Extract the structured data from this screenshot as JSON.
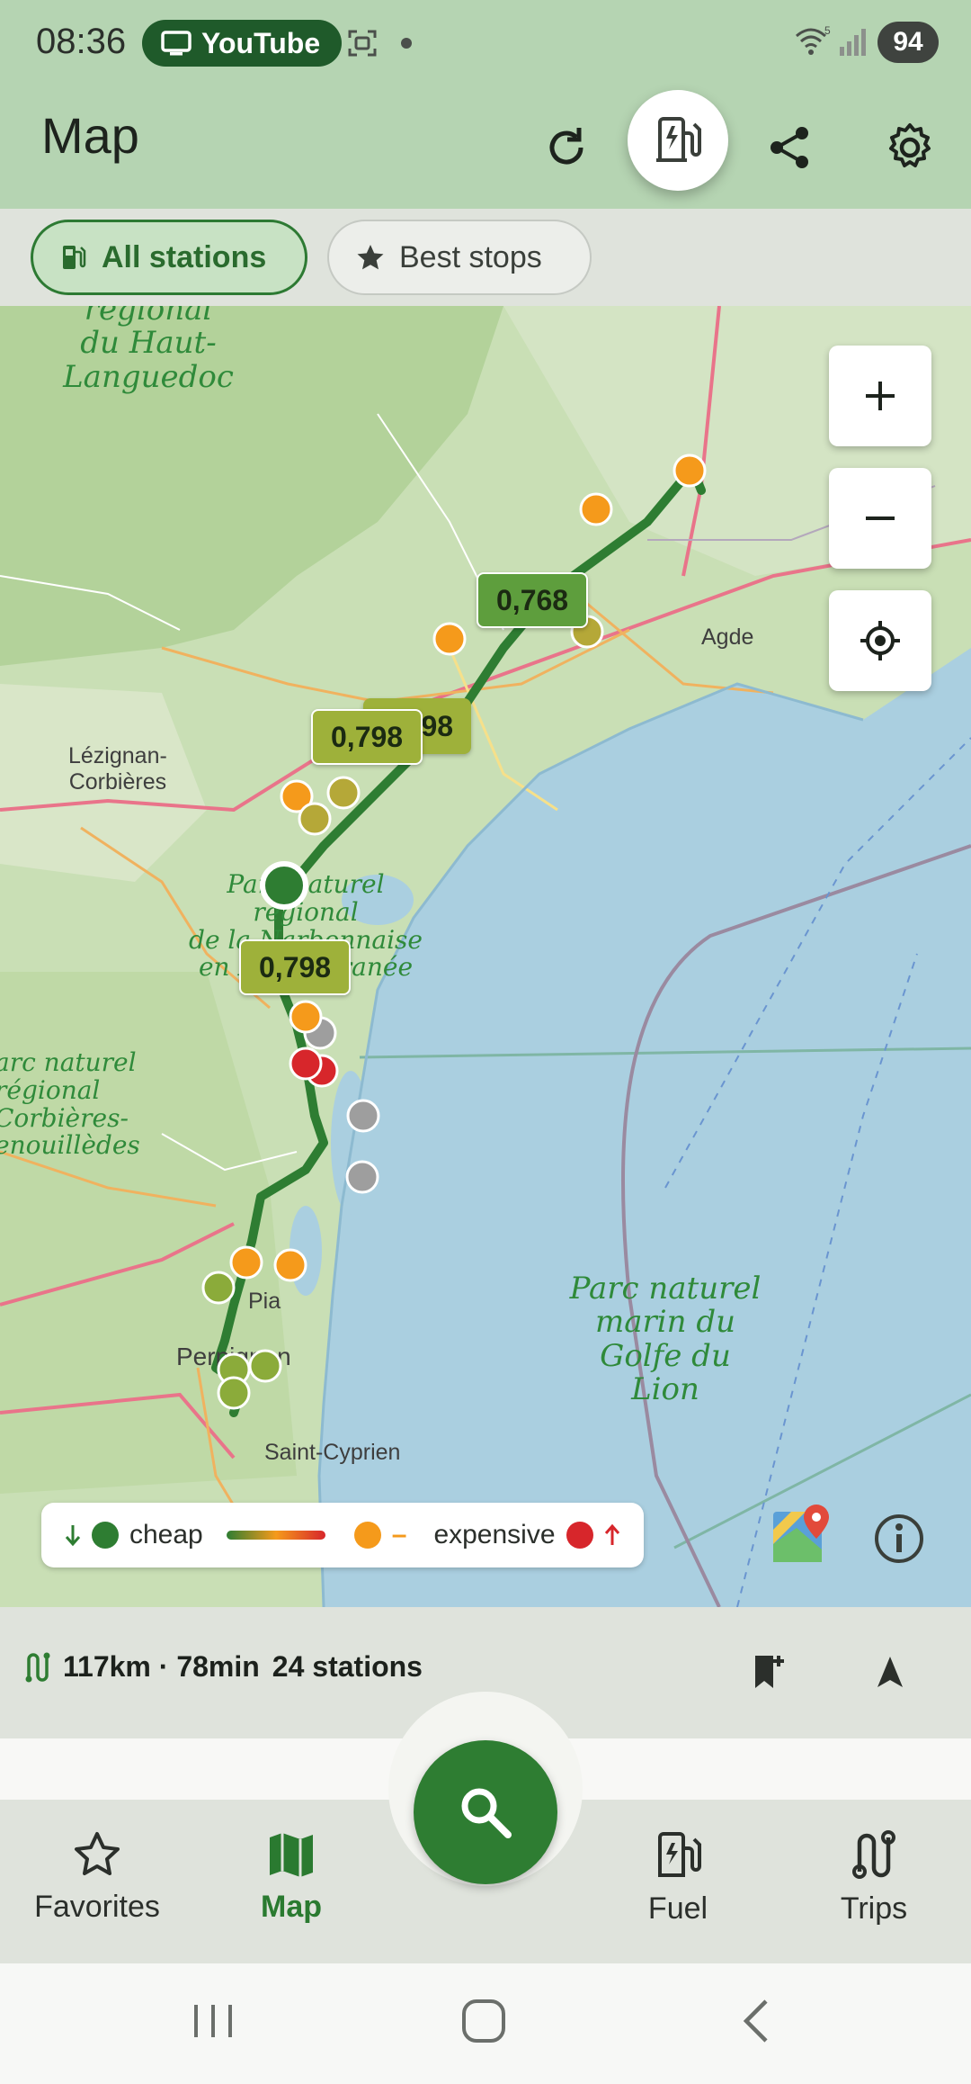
{
  "status_bar": {
    "time": "08:36",
    "app_pill": "YouTube",
    "battery": "94"
  },
  "app_bar": {
    "title": "Map",
    "icons": [
      "refresh-icon",
      "fuel-ev-icon",
      "share-icon",
      "gear-icon"
    ]
  },
  "filters": {
    "all_stations": "All stations",
    "best_stops": "Best stops"
  },
  "map": {
    "price_tags": [
      {
        "label": "0,768",
        "color": "#5e9e3d"
      },
      {
        "label": "0,798",
        "color": "#9eb13a"
      },
      {
        "label": "0,798",
        "color": "#9eb13a"
      },
      {
        "label": "98",
        "color": "#9eb13a"
      }
    ],
    "places": {
      "haut_languedoc": "régional\ndu Haut-\nLanguedoc",
      "parc_naturel_regional": "Parc naturel\nrégional\nde la Narbonnaise\nen Méditerranée",
      "corbieres": "arc naturel\nrégional\nCorbières-\nenouillèdes",
      "golfe": "Parc naturel\nmarin du\nGolfe du\nLion"
    },
    "towns": {
      "agde": "Agde",
      "lezignan": "Lézignan-\nCorbières",
      "pia": "Pia",
      "perpignan": "Perpignan",
      "saint_cyprien": "Saint-Cyprien"
    },
    "legend": {
      "cheap": "cheap",
      "expensive": "expensive",
      "cheap_color": "#2e7d32",
      "mid_color": "#f59a1b",
      "expensive_color": "#d7262b"
    },
    "controls": [
      "plus-icon",
      "minus-icon",
      "locate-icon"
    ]
  },
  "trip": {
    "summary": "117km · 78min",
    "stations": "24 stations"
  },
  "bottom_nav": {
    "favorites": "Favorites",
    "map": "Map",
    "fuel": "Fuel",
    "trips": "Trips"
  }
}
